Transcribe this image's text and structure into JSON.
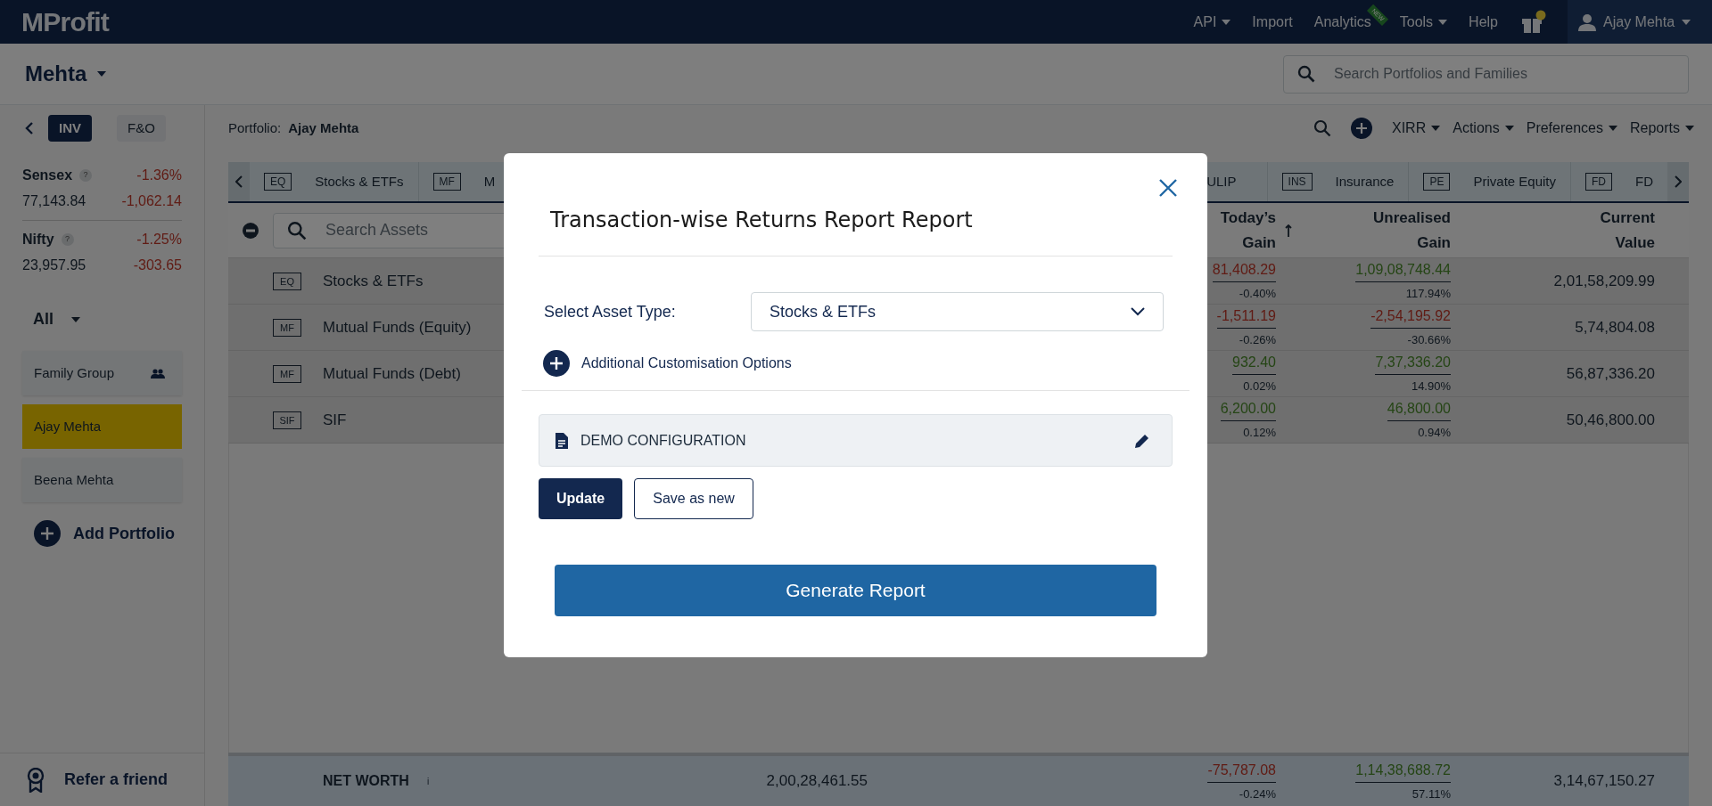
{
  "top_nav": {
    "logo": "MProfit",
    "items": [
      {
        "label": "API",
        "dropdown": true
      },
      {
        "label": "Import",
        "dropdown": false
      },
      {
        "label": "Analytics",
        "dropdown": false,
        "badge": "NEW"
      },
      {
        "label": "Tools",
        "dropdown": true
      },
      {
        "label": "Help",
        "dropdown": false
      }
    ],
    "user": "Ajay Mehta"
  },
  "family_bar": {
    "family": "Mehta",
    "search_placeholder": "Search Portfolios and Families"
  },
  "toolbar": {
    "tabs": [
      {
        "label": "INV",
        "selected": true
      },
      {
        "label": "F&O",
        "selected": false
      }
    ],
    "portfolio_label": "Portfolio:",
    "portfolio_name": "Ajay Mehta",
    "menus": [
      "XIRR",
      "Actions",
      "Preferences",
      "Reports"
    ]
  },
  "sidebar": {
    "indices": [
      {
        "name": "Sensex",
        "help_mark": "?",
        "change_pct": "-1.36%",
        "value": "77,143.84",
        "change": "-1,062.14"
      },
      {
        "name": "Nifty",
        "help_mark": "?",
        "change_pct": "-1.25%",
        "value": "23,957.95",
        "change": "-303.65"
      }
    ],
    "filter": "All",
    "portfolios": [
      {
        "label": "Family Group",
        "kind": "group",
        "selected": false
      },
      {
        "label": "Ajay Mehta",
        "kind": "portfolio",
        "selected": true
      },
      {
        "label": "Beena Mehta",
        "kind": "portfolio",
        "selected": false
      }
    ],
    "add_portfolio": "Add Portfolio",
    "refer": "Refer a friend"
  },
  "asset_tabs": {
    "left": [
      {
        "code": "EQ",
        "label": "Stocks & ETFs"
      },
      {
        "code": "MF",
        "label": "M"
      }
    ],
    "right": [
      {
        "label": "ULIP"
      },
      {
        "code": "INS",
        "label": "Insurance"
      },
      {
        "code": "PE",
        "label": "Private Equity"
      },
      {
        "code": "FD",
        "label": "FD"
      }
    ]
  },
  "table": {
    "search_placeholder": "Search Assets",
    "columns": [
      {
        "label": "Today’s Gain",
        "sorted": true
      },
      {
        "label": "Unrealised Gain",
        "sorted": false
      },
      {
        "label": "Current Value",
        "sorted": false
      }
    ],
    "rows": [
      {
        "code": "EQ",
        "name": "Stocks & ETFs",
        "todays_gain": {
          "value": "81,408.29",
          "percent": "-0.40%",
          "positive": false
        },
        "unrealised_gain": {
          "value": "1,09,08,748.44",
          "percent": "117.94%",
          "positive": true
        },
        "current_value": "2,01,58,209.99"
      },
      {
        "code": "MF",
        "name": "Mutual Funds (Equity)",
        "todays_gain": {
          "value": "-1,511.19",
          "percent": "-0.26%",
          "positive": false
        },
        "unrealised_gain": {
          "value": "-2,54,195.92",
          "percent": "-30.66%",
          "positive": false
        },
        "current_value": "5,74,804.08"
      },
      {
        "code": "MF",
        "name": "Mutual Funds (Debt)",
        "todays_gain": {
          "value": "932.40",
          "percent": "0.02%",
          "positive": true
        },
        "unrealised_gain": {
          "value": "7,37,336.20",
          "percent": "14.90%",
          "positive": true
        },
        "current_value": "56,87,336.20"
      },
      {
        "code": "SIF",
        "name": "SIF",
        "todays_gain": {
          "value": "6,200.00",
          "percent": "0.12%",
          "positive": true
        },
        "unrealised_gain": {
          "value": "46,800.00",
          "percent": "0.94%",
          "positive": true
        },
        "current_value": "50,46,800.00"
      }
    ],
    "net_worth": {
      "label": "NET WORTH",
      "info_mark": "i",
      "invested": "2,00,28,461.55",
      "todays_gain": {
        "value": "-75,787.08",
        "percent": "-0.24%",
        "positive": false
      },
      "unrealised_gain": {
        "value": "1,14,38,688.72",
        "percent": "57.11%",
        "positive": true
      },
      "current_value": "3,14,67,150.27"
    }
  },
  "modal": {
    "title": "Transaction-wise Returns Report Report",
    "asset_type_label": "Select Asset Type:",
    "asset_type": "Stocks & ETFs",
    "customisation": "Additional Customisation Options",
    "configuration": "DEMO CONFIGURATION",
    "buttons": [
      {
        "label": "Update",
        "kind": "primary"
      },
      {
        "label": "Save as new",
        "kind": "secondary"
      }
    ],
    "generate": "Generate Report"
  }
}
